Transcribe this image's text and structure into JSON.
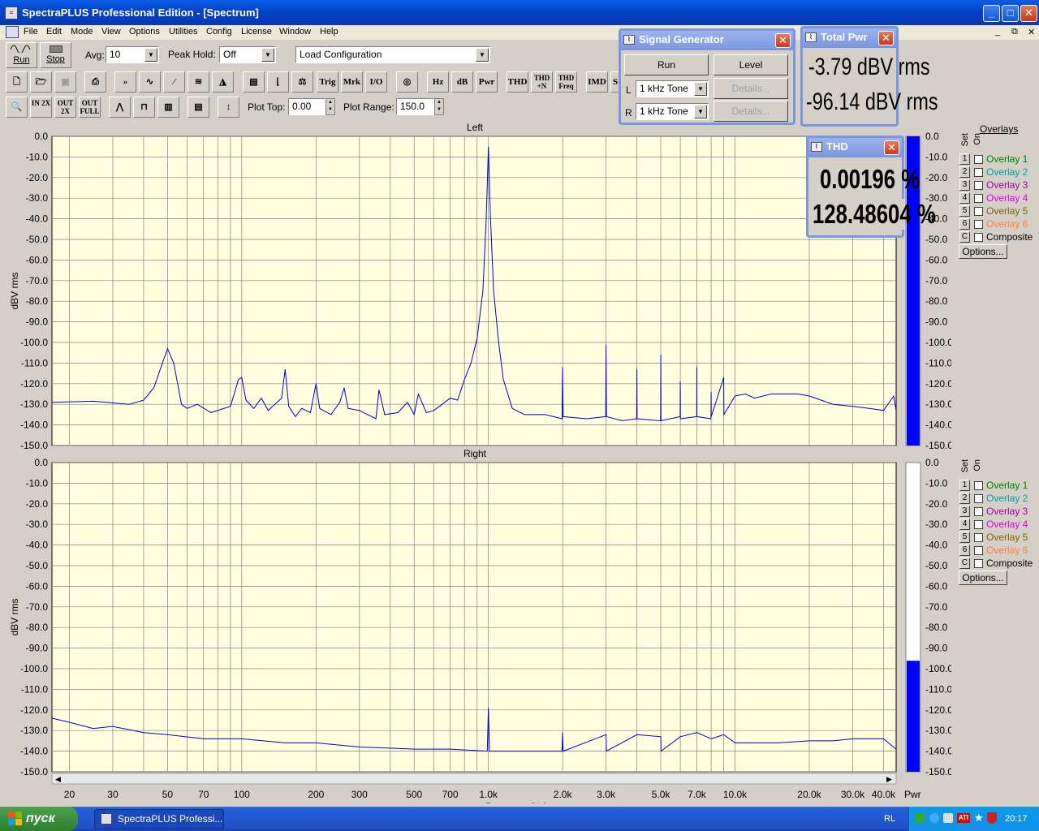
{
  "window": {
    "title": "SpectraPLUS Professional Edition - [Spectrum]",
    "min": "_",
    "max": "□",
    "close": "✕"
  },
  "menu": [
    "File",
    "Edit",
    "Mode",
    "View",
    "Options",
    "Utilities",
    "Config",
    "License",
    "Window",
    "Help"
  ],
  "mdi_controls": [
    "_",
    "⧉",
    "✕"
  ],
  "toolbar1": {
    "run_label": "Run",
    "stop_label": "Stop",
    "avg_label": "Avg:",
    "avg_value": "10",
    "peak_hold_label": "Peak Hold:",
    "peak_hold_value": "Off",
    "load_config_value": "Load Configuration"
  },
  "toolbar2": {
    "trig": "Trig",
    "mrk": "Mrk",
    "io": "I/O",
    "hz": "Hz",
    "db": "dB",
    "pwr": "Pwr",
    "thd": "THD",
    "thdn": "THD +N",
    "thdfreq": "THD Freq",
    "imd": "IMD",
    "s": "S"
  },
  "toolbar3": {
    "zoom_in": "IN 2X",
    "zoom_out": "OUT 2X",
    "zoom_full": "OUT FULL",
    "plot_top_label": "Plot Top:",
    "plot_top_value": "0.00",
    "plot_range_label": "Plot Range:",
    "plot_range_value": "150.0"
  },
  "signal_generator": {
    "title": "Signal Generator",
    "run": "Run",
    "level": "Level",
    "l_label": "L",
    "l_value": "1 kHz Tone",
    "r_label": "R",
    "r_value": "1 kHz Tone",
    "details": "Details..."
  },
  "total_pwr": {
    "title": "Total Pwr",
    "left": "-3.79 dBV rms",
    "right": "-96.14 dBV rms"
  },
  "thd_window": {
    "title": "THD",
    "left": "0.00196 %",
    "right": "128.48604 %"
  },
  "overlays": {
    "title": "Overlays",
    "set_label": "Set",
    "on_label": "On",
    "items": [
      {
        "num": "1",
        "label": "Overlay 1",
        "color": "#008000"
      },
      {
        "num": "2",
        "label": "Overlay 2",
        "color": "#00a0a0"
      },
      {
        "num": "3",
        "label": "Overlay 3",
        "color": "#a000a0"
      },
      {
        "num": "4",
        "label": "Overlay 4",
        "color": "#e000e0"
      },
      {
        "num": "5",
        "label": "Overlay 5",
        "color": "#806000"
      },
      {
        "num": "6",
        "label": "Overlay 6",
        "color": "#ff8040"
      },
      {
        "num": "C",
        "label": "Composite",
        "color": "#000000"
      }
    ],
    "options": "Options..."
  },
  "chart_data": [
    {
      "type": "line",
      "title": "Left",
      "ylabel": "dBV rms",
      "xscale": "log",
      "xlim": [
        17,
        45000
      ],
      "ylim": [
        -150,
        0
      ],
      "yticks": [
        "0.0",
        "-10.0",
        "-20.0",
        "-30.0",
        "-40.0",
        "-50.0",
        "-60.0",
        "-70.0",
        "-80.0",
        "-90.0",
        "-100.0",
        "-110.0",
        "-120.0",
        "-130.0",
        "-140.0",
        "-150.0"
      ],
      "grid": true,
      "series": [
        {
          "color": "#0000c8",
          "points": [
            [
              17,
              -129
            ],
            [
              25,
              -128.5
            ],
            [
              35,
              -130
            ],
            [
              40,
              -128
            ],
            [
              44,
              -122
            ],
            [
              48,
              -109
            ],
            [
              50,
              -103
            ],
            [
              53,
              -110
            ],
            [
              57,
              -130
            ],
            [
              60,
              -132
            ],
            [
              66,
              -130
            ],
            [
              75,
              -134
            ],
            [
              90,
              -131
            ],
            [
              97,
              -118
            ],
            [
              100,
              -117
            ],
            [
              104,
              -128
            ],
            [
              112,
              -132
            ],
            [
              120,
              -127
            ],
            [
              128,
              -133
            ],
            [
              145,
              -127
            ],
            [
              150,
              -113
            ],
            [
              155,
              -131
            ],
            [
              165,
              -136
            ],
            [
              175,
              -132
            ],
            [
              190,
              -134
            ],
            [
              200,
              -120
            ],
            [
              207,
              -132
            ],
            [
              230,
              -135
            ],
            [
              250,
              -129
            ],
            [
              260,
              -122
            ],
            [
              270,
              -132
            ],
            [
              300,
              -133
            ],
            [
              350,
              -137
            ],
            [
              360,
              -123
            ],
            [
              380,
              -135
            ],
            [
              430,
              -134
            ],
            [
              470,
              -129
            ],
            [
              500,
              -135
            ],
            [
              520,
              -125
            ],
            [
              560,
              -134
            ],
            [
              600,
              -133
            ],
            [
              650,
              -130
            ],
            [
              700,
              -127
            ],
            [
              750,
              -128
            ],
            [
              800,
              -118
            ],
            [
              850,
              -110
            ],
            [
              900,
              -98
            ],
            [
              950,
              -75
            ],
            [
              980,
              -40
            ],
            [
              1000,
              -5
            ],
            [
              1020,
              -40
            ],
            [
              1050,
              -75
            ],
            [
              1100,
              -100
            ],
            [
              1150,
              -118
            ],
            [
              1250,
              -132
            ],
            [
              1400,
              -135
            ],
            [
              1700,
              -135
            ],
            [
              1990,
              -137
            ],
            [
              2000,
              -112
            ],
            [
              2010,
              -136
            ],
            [
              2500,
              -137
            ],
            [
              2990,
              -136
            ],
            [
              3000,
              -101
            ],
            [
              3010,
              -136
            ],
            [
              3500,
              -138
            ],
            [
              3990,
              -137
            ],
            [
              4000,
              -113
            ],
            [
              4010,
              -137
            ],
            [
              4990,
              -138
            ],
            [
              5000,
              -106
            ],
            [
              5010,
              -138
            ],
            [
              5990,
              -136
            ],
            [
              6000,
              -119
            ],
            [
              6010,
              -137
            ],
            [
              6990,
              -136
            ],
            [
              7000,
              -112
            ],
            [
              7010,
              -136
            ],
            [
              7990,
              -137
            ],
            [
              8000,
              -124
            ],
            [
              8010,
              -136
            ],
            [
              9000,
              -117
            ],
            [
              9010,
              -135
            ],
            [
              10000,
              -126
            ],
            [
              11000,
              -125
            ],
            [
              12000,
              -127
            ],
            [
              14000,
              -125
            ],
            [
              16000,
              -125
            ],
            [
              18000,
              -125
            ],
            [
              20000,
              -126
            ],
            [
              25000,
              -130
            ],
            [
              30000,
              -131
            ],
            [
              35000,
              -132
            ],
            [
              40000,
              -133
            ],
            [
              44000,
              -126
            ],
            [
              45000,
              -133
            ]
          ]
        }
      ]
    },
    {
      "type": "line",
      "title": "Right",
      "ylabel": "dBV rms",
      "xlabel": "Frequency (Hz)",
      "xscale": "log",
      "xlim": [
        17,
        45000
      ],
      "ylim": [
        -150,
        0
      ],
      "yticks": [
        "0.0",
        "-10.0",
        "-20.0",
        "-30.0",
        "-40.0",
        "-50.0",
        "-60.0",
        "-70.0",
        "-80.0",
        "-90.0",
        "-100.0",
        "-110.0",
        "-120.0",
        "-130.0",
        "-140.0",
        "-150.0"
      ],
      "xticks": [
        "20",
        "30",
        "50",
        "70",
        "100",
        "200",
        "300",
        "500",
        "700",
        "1.0k",
        "2.0k",
        "3.0k",
        "5.0k",
        "7.0k",
        "10.0k",
        "20.0k",
        "30.0k",
        "40.0k"
      ],
      "grid": true,
      "series": [
        {
          "color": "#0000c8",
          "points": [
            [
              17,
              -124
            ],
            [
              20,
              -126
            ],
            [
              25,
              -129
            ],
            [
              30,
              -128
            ],
            [
              40,
              -131
            ],
            [
              50,
              -132
            ],
            [
              70,
              -134
            ],
            [
              100,
              -134
            ],
            [
              150,
              -136
            ],
            [
              200,
              -136
            ],
            [
              300,
              -138
            ],
            [
              500,
              -139
            ],
            [
              700,
              -139
            ],
            [
              990,
              -140
            ],
            [
              1000,
              -119
            ],
            [
              1010,
              -140
            ],
            [
              1500,
              -140
            ],
            [
              1990,
              -140
            ],
            [
              2000,
              -131
            ],
            [
              2010,
              -140
            ],
            [
              3000,
              -132
            ],
            [
              3010,
              -140
            ],
            [
              4000,
              -132
            ],
            [
              5000,
              -133
            ],
            [
              5010,
              -140
            ],
            [
              6000,
              -133
            ],
            [
              7000,
              -131
            ],
            [
              8000,
              -134
            ],
            [
              9000,
              -132
            ],
            [
              10000,
              -136
            ],
            [
              15000,
              -136
            ],
            [
              20000,
              -135
            ],
            [
              25000,
              -135
            ],
            [
              30000,
              -134
            ],
            [
              35000,
              -134
            ],
            [
              40000,
              -134
            ],
            [
              45000,
              -139
            ]
          ]
        }
      ]
    }
  ],
  "bar_meters": {
    "pwr_label": "Pwr",
    "left_level_db": 0.0,
    "right_level_db": -96.14
  },
  "taskbar": {
    "start": "пуск",
    "task": "SpectraPLUS Professi...",
    "lang": "RL",
    "time": "20:17"
  }
}
